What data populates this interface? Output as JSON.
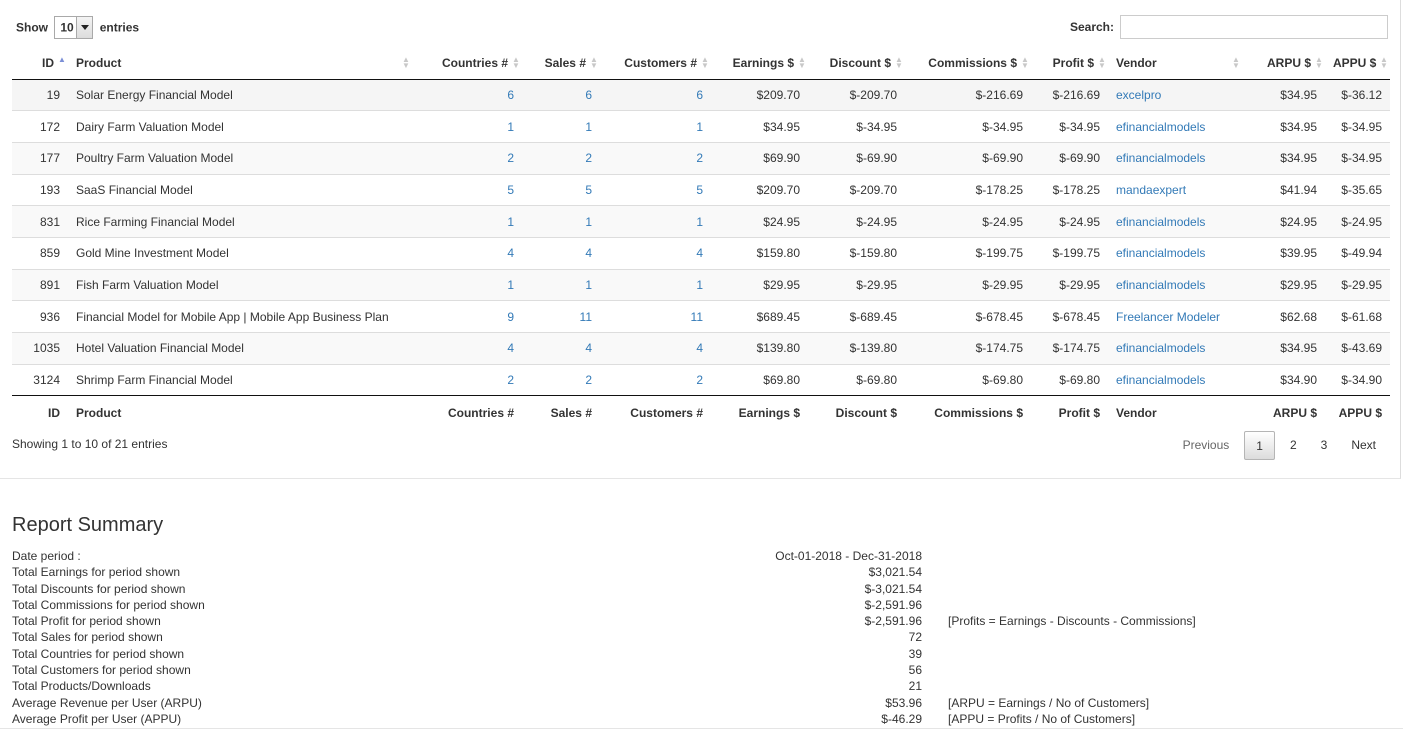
{
  "controls": {
    "show_label": "Show",
    "length_value": "10",
    "entries_label": "entries",
    "search_label": "Search:",
    "search_value": ""
  },
  "table": {
    "headers": {
      "id": "ID",
      "product": "Product",
      "countries": "Countries #",
      "sales": "Sales #",
      "customers": "Customers #",
      "earnings": "Earnings $",
      "discount": "Discount $",
      "commissions": "Commissions $",
      "profit": "Profit $",
      "vendor": "Vendor",
      "arpu": "ARPU $",
      "appu": "APPU $"
    },
    "sorted_column": "id",
    "rows": [
      {
        "id": "19",
        "product": "Solar Energy Financial Model",
        "countries": "6",
        "sales": "6",
        "customers": "6",
        "earnings": "$209.70",
        "discount": "$-209.70",
        "commissions": "$-216.69",
        "profit": "$-216.69",
        "vendor": "excelpro",
        "arpu": "$34.95",
        "appu": "$-36.12"
      },
      {
        "id": "172",
        "product": "Dairy Farm Valuation Model",
        "countries": "1",
        "sales": "1",
        "customers": "1",
        "earnings": "$34.95",
        "discount": "$-34.95",
        "commissions": "$-34.95",
        "profit": "$-34.95",
        "vendor": "efinancialmodels",
        "arpu": "$34.95",
        "appu": "$-34.95"
      },
      {
        "id": "177",
        "product": "Poultry Farm Valuation Model",
        "countries": "2",
        "sales": "2",
        "customers": "2",
        "earnings": "$69.90",
        "discount": "$-69.90",
        "commissions": "$-69.90",
        "profit": "$-69.90",
        "vendor": "efinancialmodels",
        "arpu": "$34.95",
        "appu": "$-34.95"
      },
      {
        "id": "193",
        "product": "SaaS Financial Model",
        "countries": "5",
        "sales": "5",
        "customers": "5",
        "earnings": "$209.70",
        "discount": "$-209.70",
        "commissions": "$-178.25",
        "profit": "$-178.25",
        "vendor": "mandaexpert",
        "arpu": "$41.94",
        "appu": "$-35.65"
      },
      {
        "id": "831",
        "product": "Rice Farming Financial Model",
        "countries": "1",
        "sales": "1",
        "customers": "1",
        "earnings": "$24.95",
        "discount": "$-24.95",
        "commissions": "$-24.95",
        "profit": "$-24.95",
        "vendor": "efinancialmodels",
        "arpu": "$24.95",
        "appu": "$-24.95"
      },
      {
        "id": "859",
        "product": "Gold Mine Investment Model",
        "countries": "4",
        "sales": "4",
        "customers": "4",
        "earnings": "$159.80",
        "discount": "$-159.80",
        "commissions": "$-199.75",
        "profit": "$-199.75",
        "vendor": "efinancialmodels",
        "arpu": "$39.95",
        "appu": "$-49.94"
      },
      {
        "id": "891",
        "product": "Fish Farm Valuation Model",
        "countries": "1",
        "sales": "1",
        "customers": "1",
        "earnings": "$29.95",
        "discount": "$-29.95",
        "commissions": "$-29.95",
        "profit": "$-29.95",
        "vendor": "efinancialmodels",
        "arpu": "$29.95",
        "appu": "$-29.95"
      },
      {
        "id": "936",
        "product": "Financial Model for Mobile App | Mobile App Business Plan",
        "countries": "9",
        "sales": "11",
        "customers": "11",
        "earnings": "$689.45",
        "discount": "$-689.45",
        "commissions": "$-678.45",
        "profit": "$-678.45",
        "vendor": "Freelancer Modeler",
        "arpu": "$62.68",
        "appu": "$-61.68"
      },
      {
        "id": "1035",
        "product": "Hotel Valuation Financial Model",
        "countries": "4",
        "sales": "4",
        "customers": "4",
        "earnings": "$139.80",
        "discount": "$-139.80",
        "commissions": "$-174.75",
        "profit": "$-174.75",
        "vendor": "efinancialmodels",
        "arpu": "$34.95",
        "appu": "$-43.69"
      },
      {
        "id": "3124",
        "product": "Shrimp Farm Financial Model",
        "countries": "2",
        "sales": "2",
        "customers": "2",
        "earnings": "$69.80",
        "discount": "$-69.80",
        "commissions": "$-69.80",
        "profit": "$-69.80",
        "vendor": "efinancialmodels",
        "arpu": "$34.90",
        "appu": "$-34.90"
      }
    ]
  },
  "info": "Showing 1 to 10 of 21 entries",
  "pagination": {
    "previous": "Previous",
    "pages": [
      "1",
      "2",
      "3"
    ],
    "current": "1",
    "next": "Next"
  },
  "summary": {
    "title": "Report Summary",
    "rows": [
      {
        "label": "Date period :",
        "value": "Oct-01-2018 - Dec-31-2018",
        "note": ""
      },
      {
        "label": "Total Earnings for period shown",
        "value": "$3,021.54",
        "note": ""
      },
      {
        "label": "Total Discounts for period shown",
        "value": "$-3,021.54",
        "note": ""
      },
      {
        "label": "Total Commissions for period shown",
        "value": "$-2,591.96",
        "note": ""
      },
      {
        "label": "Total Profit for period shown",
        "value": "$-2,591.96",
        "note": "[Profits = Earnings - Discounts - Commissions]"
      },
      {
        "label": "Total Sales for period shown",
        "value": "72",
        "note": ""
      },
      {
        "label": "Total Countries for period shown",
        "value": "39",
        "note": ""
      },
      {
        "label": "Total Customers for period shown",
        "value": "56",
        "note": ""
      },
      {
        "label": "Total Products/Downloads",
        "value": "21",
        "note": ""
      },
      {
        "label": "Average Revenue per User (ARPU)",
        "value": "$53.96",
        "note": "[ARPU = Earnings / No of Customers]"
      },
      {
        "label": "Average Profit per User (APPU)",
        "value": "$-46.29",
        "note": "[APPU = Profits / No of Customers]"
      }
    ]
  },
  "colors": {
    "link": "#337ab7",
    "sort_active": "#7b8fd6",
    "row_stripe": "#f9f9f9"
  }
}
